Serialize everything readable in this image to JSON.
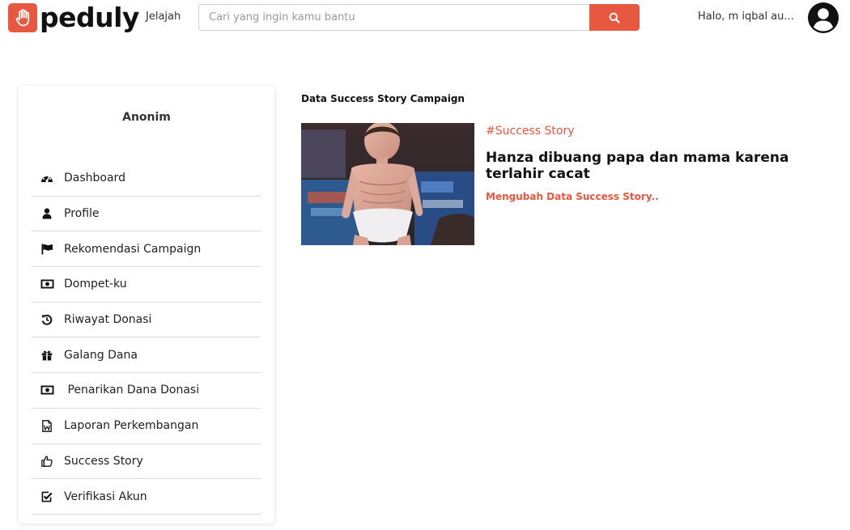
{
  "header": {
    "brand": "peduly",
    "nav_explore": "Jelajah",
    "search_placeholder": "Cari yang ingin kamu bantu",
    "greeting": "Halo, m iqbal au..."
  },
  "sidebar": {
    "name": "Anonim",
    "items": [
      {
        "label": "Dashboard",
        "icon": "dashboard-icon"
      },
      {
        "label": "Profile",
        "icon": "user-icon"
      },
      {
        "label": "Rekomendasi Campaign",
        "icon": "flag-icon"
      },
      {
        "label": "Dompet-ku",
        "icon": "money-icon"
      },
      {
        "label": "Riwayat Donasi",
        "icon": "history-icon"
      },
      {
        "label": "Galang Dana",
        "icon": "gift-icon"
      },
      {
        "label": " Penarikan Dana Donasi",
        "icon": "money-icon"
      },
      {
        "label": "Laporan Perkembangan",
        "icon": "word-file-icon"
      },
      {
        "label": "Success Story",
        "icon": "thumbs-up-icon"
      },
      {
        "label": "Verifikasi Akun",
        "icon": "check-square-icon"
      }
    ]
  },
  "main": {
    "title": "Data Success Story Campaign",
    "story": {
      "tag": "#Success Story",
      "title": "Hanza dibuang papa dan mama karena terlahir cacat",
      "action": "Mengubah Data Success Story.."
    }
  },
  "colors": {
    "accent": "#e8573f",
    "text": "#222222",
    "divider": "#dcdcdc"
  }
}
